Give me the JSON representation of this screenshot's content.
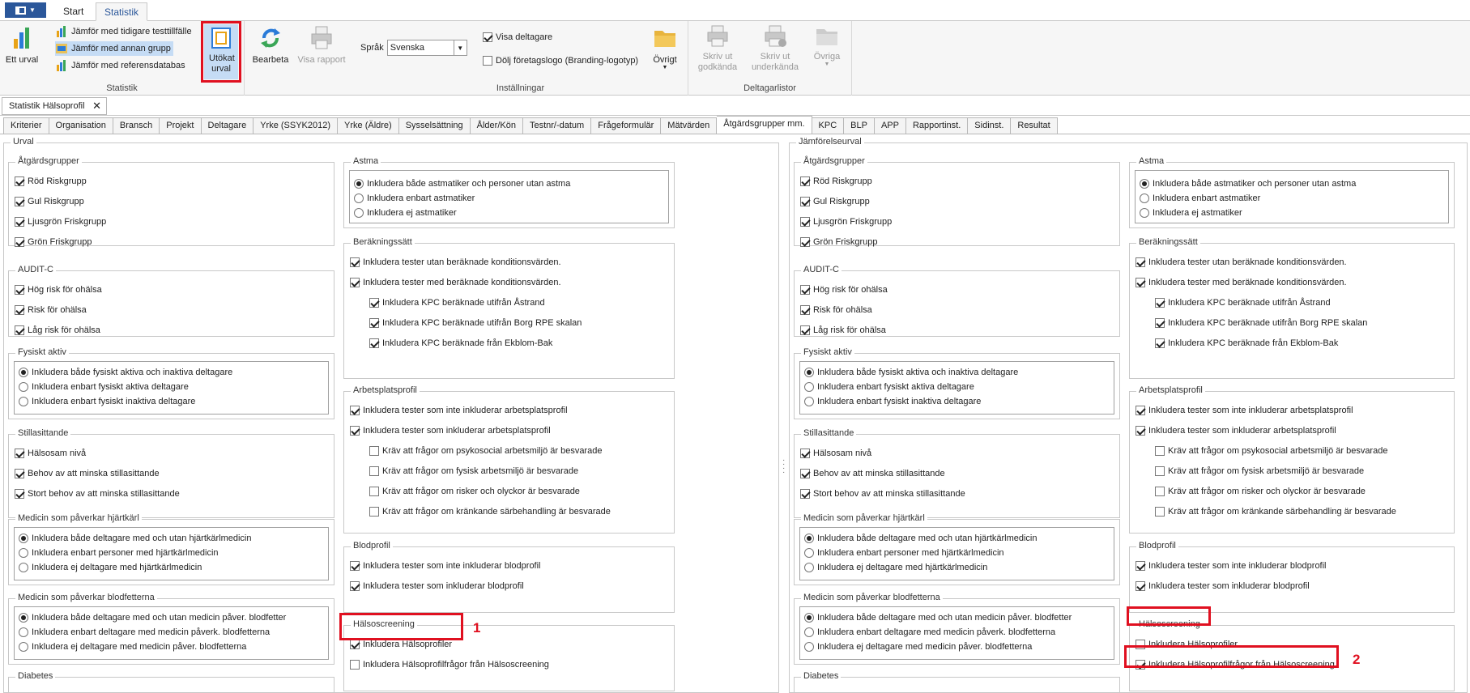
{
  "ribbon": {
    "tabs": [
      "Start",
      "Statistik"
    ],
    "active_tab": "Statistik",
    "groups": {
      "statistik": {
        "label": "Statistik",
        "ett_urval": "Ett urval",
        "jamfor_tidigare": "Jämför med tidigare testtillfälle",
        "jamfor_annan": "Jämför med annan grupp",
        "jamfor_referens": "Jämför med referensdatabas",
        "utokat_urval": "Utökat urval",
        "bearbeta": "Bearbeta",
        "visa_rapport": "Visa rapport"
      },
      "installningar": {
        "label": "Inställningar",
        "sprak_label": "Språk",
        "sprak_value": "Svenska",
        "visa_deltagare": "Visa deltagare",
        "dolj_logo": "Dölj företagslogo (Branding-logotyp)",
        "ovrigt": "Övrigt"
      },
      "deltagarlistor": {
        "label": "Deltagarlistor",
        "skriv_godkanda": "Skriv ut godkända",
        "skriv_underkanda": "Skriv ut underkända",
        "ovriga": "Övriga"
      }
    }
  },
  "doc_tab": "Statistik Hälsoprofil",
  "sub_tabs": [
    "Kriterier",
    "Organisation",
    "Bransch",
    "Projekt",
    "Deltagare",
    "Yrke (SSYK2012)",
    "Yrke (Äldre)",
    "Sysselsättning",
    "Ålder/Kön",
    "Testnr/-datum",
    "Frågeformulär",
    "Mätvärden",
    "Åtgärdsgrupper mm.",
    "KPC",
    "BLP",
    "APP",
    "Rapportinst.",
    "Sidinst.",
    "Resultat"
  ],
  "active_sub_tab": "Åtgärdsgrupper mm.",
  "panels": [
    {
      "title": "Urval",
      "atgardsgrupper": {
        "title": "Åtgärdsgrupper",
        "items": [
          {
            "label": "Röd Riskgrupp",
            "checked": true
          },
          {
            "label": "Gul Riskgrupp",
            "checked": true
          },
          {
            "label": "Ljusgrön Friskgrupp",
            "checked": true
          },
          {
            "label": "Grön Friskgrupp",
            "checked": true
          }
        ]
      },
      "audit": {
        "title": "AUDIT-C",
        "items": [
          {
            "label": "Hög risk för ohälsa",
            "checked": true
          },
          {
            "label": "Risk för ohälsa",
            "checked": true
          },
          {
            "label": "Låg risk för ohälsa",
            "checked": true
          }
        ]
      },
      "fysiskt": {
        "title": "Fysiskt aktiv",
        "items": [
          {
            "label": "Inkludera både fysiskt aktiva och inaktiva deltagare",
            "checked": true
          },
          {
            "label": "Inkludera enbart fysiskt aktiva deltagare",
            "checked": false
          },
          {
            "label": "Inkludera enbart fysiskt inaktiva deltagare",
            "checked": false
          }
        ]
      },
      "stillasittande": {
        "title": "Stillasittande",
        "items": [
          {
            "label": "Hälsosam nivå",
            "checked": true
          },
          {
            "label": "Behov av att minska stillasittande",
            "checked": true
          },
          {
            "label": "Stort behov av att minska stillasittande",
            "checked": true
          }
        ]
      },
      "hjartkarl": {
        "title": "Medicin som påverkar hjärtkärl",
        "items": [
          {
            "label": "Inkludera både deltagare med och utan hjärtkärlmedicin",
            "checked": true
          },
          {
            "label": "Inkludera enbart personer med hjärtkärlmedicin",
            "checked": false
          },
          {
            "label": "Inkludera ej deltagare med hjärtkärlmedicin",
            "checked": false
          }
        ]
      },
      "blodfetterna": {
        "title": "Medicin som påverkar blodfetterna",
        "items": [
          {
            "label": "Inkludera både deltagare med och utan medicin påver. blodfetter",
            "checked": true
          },
          {
            "label": "Inkludera enbart deltagare med medicin påverk. blodfetterna",
            "checked": false
          },
          {
            "label": "Inkludera ej deltagare med medicin påver. blodfetterna",
            "checked": false
          }
        ]
      },
      "diabetes": {
        "title": "Diabetes"
      },
      "astma": {
        "title": "Astma",
        "items": [
          {
            "label": "Inkludera både astmatiker och personer utan astma",
            "checked": true
          },
          {
            "label": "Inkludera enbart astmatiker",
            "checked": false
          },
          {
            "label": "Inkludera ej astmatiker",
            "checked": false
          }
        ]
      },
      "berakning": {
        "title": "Beräkningssätt",
        "items": [
          {
            "label": "Inkludera tester utan beräknade konditionsvärden.",
            "checked": true
          },
          {
            "label": "Inkludera tester med beräknade konditionsvärden.",
            "checked": true
          },
          {
            "label": "Inkludera KPC beräknade utifrån Åstrand",
            "checked": true
          },
          {
            "label": "Inkludera KPC beräknade utifrån Borg RPE skalan",
            "checked": true
          },
          {
            "label": "Inkludera KPC beräknade från Ekblom-Bak",
            "checked": true
          }
        ]
      },
      "arbetsplats": {
        "title": "Arbetsplatsprofil",
        "items": [
          {
            "label": "Inkludera tester som inte inkluderar arbetsplatsprofil",
            "checked": true
          },
          {
            "label": "Inkludera tester som inkluderar arbetsplatsprofil",
            "checked": true
          },
          {
            "label": "Kräv att frågor om psykosocial arbetsmiljö är besvarade",
            "checked": false
          },
          {
            "label": "Kräv att frågor om fysisk arbetsmiljö är besvarade",
            "checked": false
          },
          {
            "label": "Kräv att frågor om risker och olyckor är besvarade",
            "checked": false
          },
          {
            "label": "Kräv att frågor om kränkande särbehandling är besvarade",
            "checked": false
          }
        ]
      },
      "blodprofil": {
        "title": "Blodprofil",
        "items": [
          {
            "label": "Inkludera tester som inte inkluderar blodprofil",
            "checked": true
          },
          {
            "label": "Inkludera tester som inkluderar blodprofil",
            "checked": true
          }
        ]
      },
      "halsoscreening": {
        "title": "Hälsoscreening",
        "items": [
          {
            "label": "Inkludera Hälsoprofiler",
            "checked": true
          },
          {
            "label": "Inkludera Hälsoprofilfrågor från Hälsoscreening",
            "checked": false
          }
        ]
      }
    },
    {
      "title": "Jämförelseurval",
      "atgardsgrupper": {
        "title": "Åtgärdsgrupper",
        "items": [
          {
            "label": "Röd Riskgrupp",
            "checked": true
          },
          {
            "label": "Gul Riskgrupp",
            "checked": true
          },
          {
            "label": "Ljusgrön Friskgrupp",
            "checked": true
          },
          {
            "label": "Grön Friskgrupp",
            "checked": true
          }
        ]
      },
      "audit": {
        "title": "AUDIT-C",
        "items": [
          {
            "label": "Hög risk för ohälsa",
            "checked": true
          },
          {
            "label": "Risk för ohälsa",
            "checked": true
          },
          {
            "label": "Låg risk för ohälsa",
            "checked": true
          }
        ]
      },
      "fysiskt": {
        "title": "Fysiskt aktiv",
        "items": [
          {
            "label": "Inkludera både fysiskt aktiva och inaktiva deltagare",
            "checked": true
          },
          {
            "label": "Inkludera enbart fysiskt aktiva deltagare",
            "checked": false
          },
          {
            "label": "Inkludera enbart fysiskt inaktiva deltagare",
            "checked": false
          }
        ]
      },
      "stillasittande": {
        "title": "Stillasittande",
        "items": [
          {
            "label": "Hälsosam nivå",
            "checked": true
          },
          {
            "label": "Behov av att minska stillasittande",
            "checked": true
          },
          {
            "label": "Stort behov av att minska stillasittande",
            "checked": true
          }
        ]
      },
      "hjartkarl": {
        "title": "Medicin som påverkar hjärtkärl",
        "items": [
          {
            "label": "Inkludera både deltagare med och utan hjärtkärlmedicin",
            "checked": true
          },
          {
            "label": "Inkludera enbart personer med hjärtkärlmedicin",
            "checked": false
          },
          {
            "label": "Inkludera ej deltagare med hjärtkärlmedicin",
            "checked": false
          }
        ]
      },
      "blodfetterna": {
        "title": "Medicin som påverkar blodfetterna",
        "items": [
          {
            "label": "Inkludera både deltagare med och utan medicin påver. blodfetter",
            "checked": true
          },
          {
            "label": "Inkludera enbart deltagare med medicin påverk. blodfetterna",
            "checked": false
          },
          {
            "label": "Inkludera ej deltagare med medicin påver. blodfetterna",
            "checked": false
          }
        ]
      },
      "diabetes": {
        "title": "Diabetes"
      },
      "astma": {
        "title": "Astma",
        "items": [
          {
            "label": "Inkludera både astmatiker och personer utan astma",
            "checked": true
          },
          {
            "label": "Inkludera enbart astmatiker",
            "checked": false
          },
          {
            "label": "Inkludera ej astmatiker",
            "checked": false
          }
        ]
      },
      "berakning": {
        "title": "Beräkningssätt",
        "items": [
          {
            "label": "Inkludera tester utan beräknade konditionsvärden.",
            "checked": true
          },
          {
            "label": "Inkludera tester med beräknade konditionsvärden.",
            "checked": true
          },
          {
            "label": "Inkludera KPC beräknade utifrån Åstrand",
            "checked": true
          },
          {
            "label": "Inkludera KPC beräknade utifrån Borg RPE skalan",
            "checked": true
          },
          {
            "label": "Inkludera KPC beräknade från Ekblom-Bak",
            "checked": true
          }
        ]
      },
      "arbetsplats": {
        "title": "Arbetsplatsprofil",
        "items": [
          {
            "label": "Inkludera tester som inte inkluderar arbetsplatsprofil",
            "checked": true
          },
          {
            "label": "Inkludera tester som inkluderar arbetsplatsprofil",
            "checked": true
          },
          {
            "label": "Kräv att frågor om psykosocial arbetsmiljö är besvarade",
            "checked": false
          },
          {
            "label": "Kräv att frågor om fysisk arbetsmiljö är besvarade",
            "checked": false
          },
          {
            "label": "Kräv att frågor om risker och olyckor är besvarade",
            "checked": false
          },
          {
            "label": "Kräv att frågor om kränkande särbehandling är besvarade",
            "checked": false
          }
        ]
      },
      "blodprofil": {
        "title": "Blodprofil",
        "items": [
          {
            "label": "Inkludera tester som inte inkluderar blodprofil",
            "checked": true
          },
          {
            "label": "Inkludera tester som inkluderar blodprofil",
            "checked": true
          }
        ]
      },
      "halsoscreening": {
        "title": "Hälsoscreening",
        "items": [
          {
            "label": "Inkludera Hälsoprofiler",
            "checked": false
          },
          {
            "label": "Inkludera Hälsoprofilfrågor från Hälsoscreening",
            "checked": true
          }
        ]
      }
    }
  ],
  "annotations": {
    "marker_1": "1",
    "marker_2": "2",
    "color": "#e01020"
  }
}
